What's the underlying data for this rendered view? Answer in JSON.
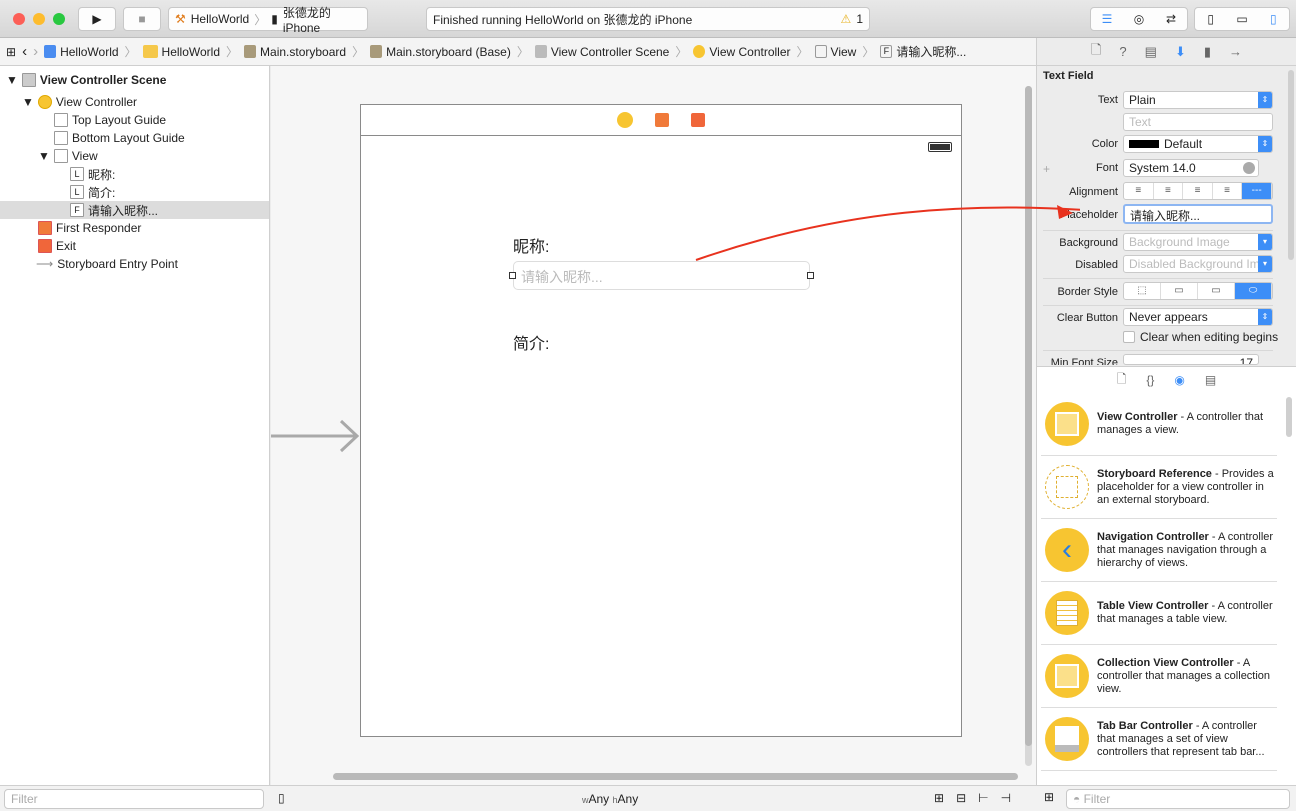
{
  "toolbar": {
    "scheme": "HelloWorld",
    "device": "张德龙的 iPhone",
    "status": "Finished running HelloWorld on 张德龙的 iPhone",
    "warning_count": "1"
  },
  "breadcrumb": [
    "HelloWorld",
    "HelloWorld",
    "Main.storyboard",
    "Main.storyboard (Base)",
    "View Controller Scene",
    "View Controller",
    "View",
    "请输入昵称..."
  ],
  "navigator": {
    "items": [
      {
        "label": "View Controller Scene",
        "icon": "scene-icon"
      },
      {
        "label": "View Controller",
        "icon": "view-controller-icon"
      },
      {
        "label": "Top Layout Guide",
        "icon": "layout-guide-icon"
      },
      {
        "label": "Bottom Layout Guide",
        "icon": "layout-guide-icon"
      },
      {
        "label": "View",
        "icon": "view-icon"
      },
      {
        "label": "昵称:",
        "icon": "label-icon",
        "glyph": "L"
      },
      {
        "label": "简介:",
        "icon": "label-icon",
        "glyph": "L"
      },
      {
        "label": "请输入昵称...",
        "icon": "text-field-icon",
        "glyph": "F"
      },
      {
        "label": "First Responder",
        "icon": "first-responder-icon"
      },
      {
        "label": "Exit",
        "icon": "exit-icon"
      },
      {
        "label": "Storyboard Entry Point",
        "icon": "arrow-icon"
      }
    ],
    "filter_placeholder": "Filter"
  },
  "canvas": {
    "nickname_label": "昵称:",
    "textfield_placeholder": "请输入昵称...",
    "intro_label": "简介:",
    "size_w": "w",
    "size_w_val": "Any",
    "size_h": "h",
    "size_h_val": "Any"
  },
  "inspector": {
    "section": "Text Field",
    "text_label": "Text",
    "text_value": "Plain",
    "text_placeholder": "Text",
    "color_label": "Color",
    "color_value": "Default",
    "font_label": "Font",
    "font_value": "System 14.0",
    "alignment_label": "Alignment",
    "placeholder_label": "Placeholder",
    "placeholder_value": "请输入昵称...",
    "background_label": "Background",
    "background_placeholder": "Background Image",
    "disabled_label": "Disabled",
    "disabled_placeholder": "Disabled Background Image",
    "border_label": "Border Style",
    "clear_label": "Clear Button",
    "clear_value": "Never appears",
    "clear_editing": "Clear when editing begins",
    "minfont_label": "Min Font Size",
    "minfont_value": "17"
  },
  "library": {
    "items": [
      {
        "title": "View Controller",
        "desc": " - A controller that manages a view."
      },
      {
        "title": "Storyboard Reference",
        "desc": " - Provides a placeholder for a view controller in an external storyboard."
      },
      {
        "title": "Navigation Controller",
        "desc": " - A controller that manages navigation through a hierarchy of views."
      },
      {
        "title": "Table View Controller",
        "desc": " - A controller that manages a table view."
      },
      {
        "title": "Collection View Controller",
        "desc": " - A controller that manages a collection view."
      },
      {
        "title": "Tab Bar Controller",
        "desc": " - A controller that manages a set of view controllers that represent tab bar..."
      }
    ],
    "filter_placeholder": "Filter"
  },
  "colors": {
    "accent": "#3d8ef7",
    "arrow": "#e8321e",
    "library_icon": "#f7c531"
  }
}
